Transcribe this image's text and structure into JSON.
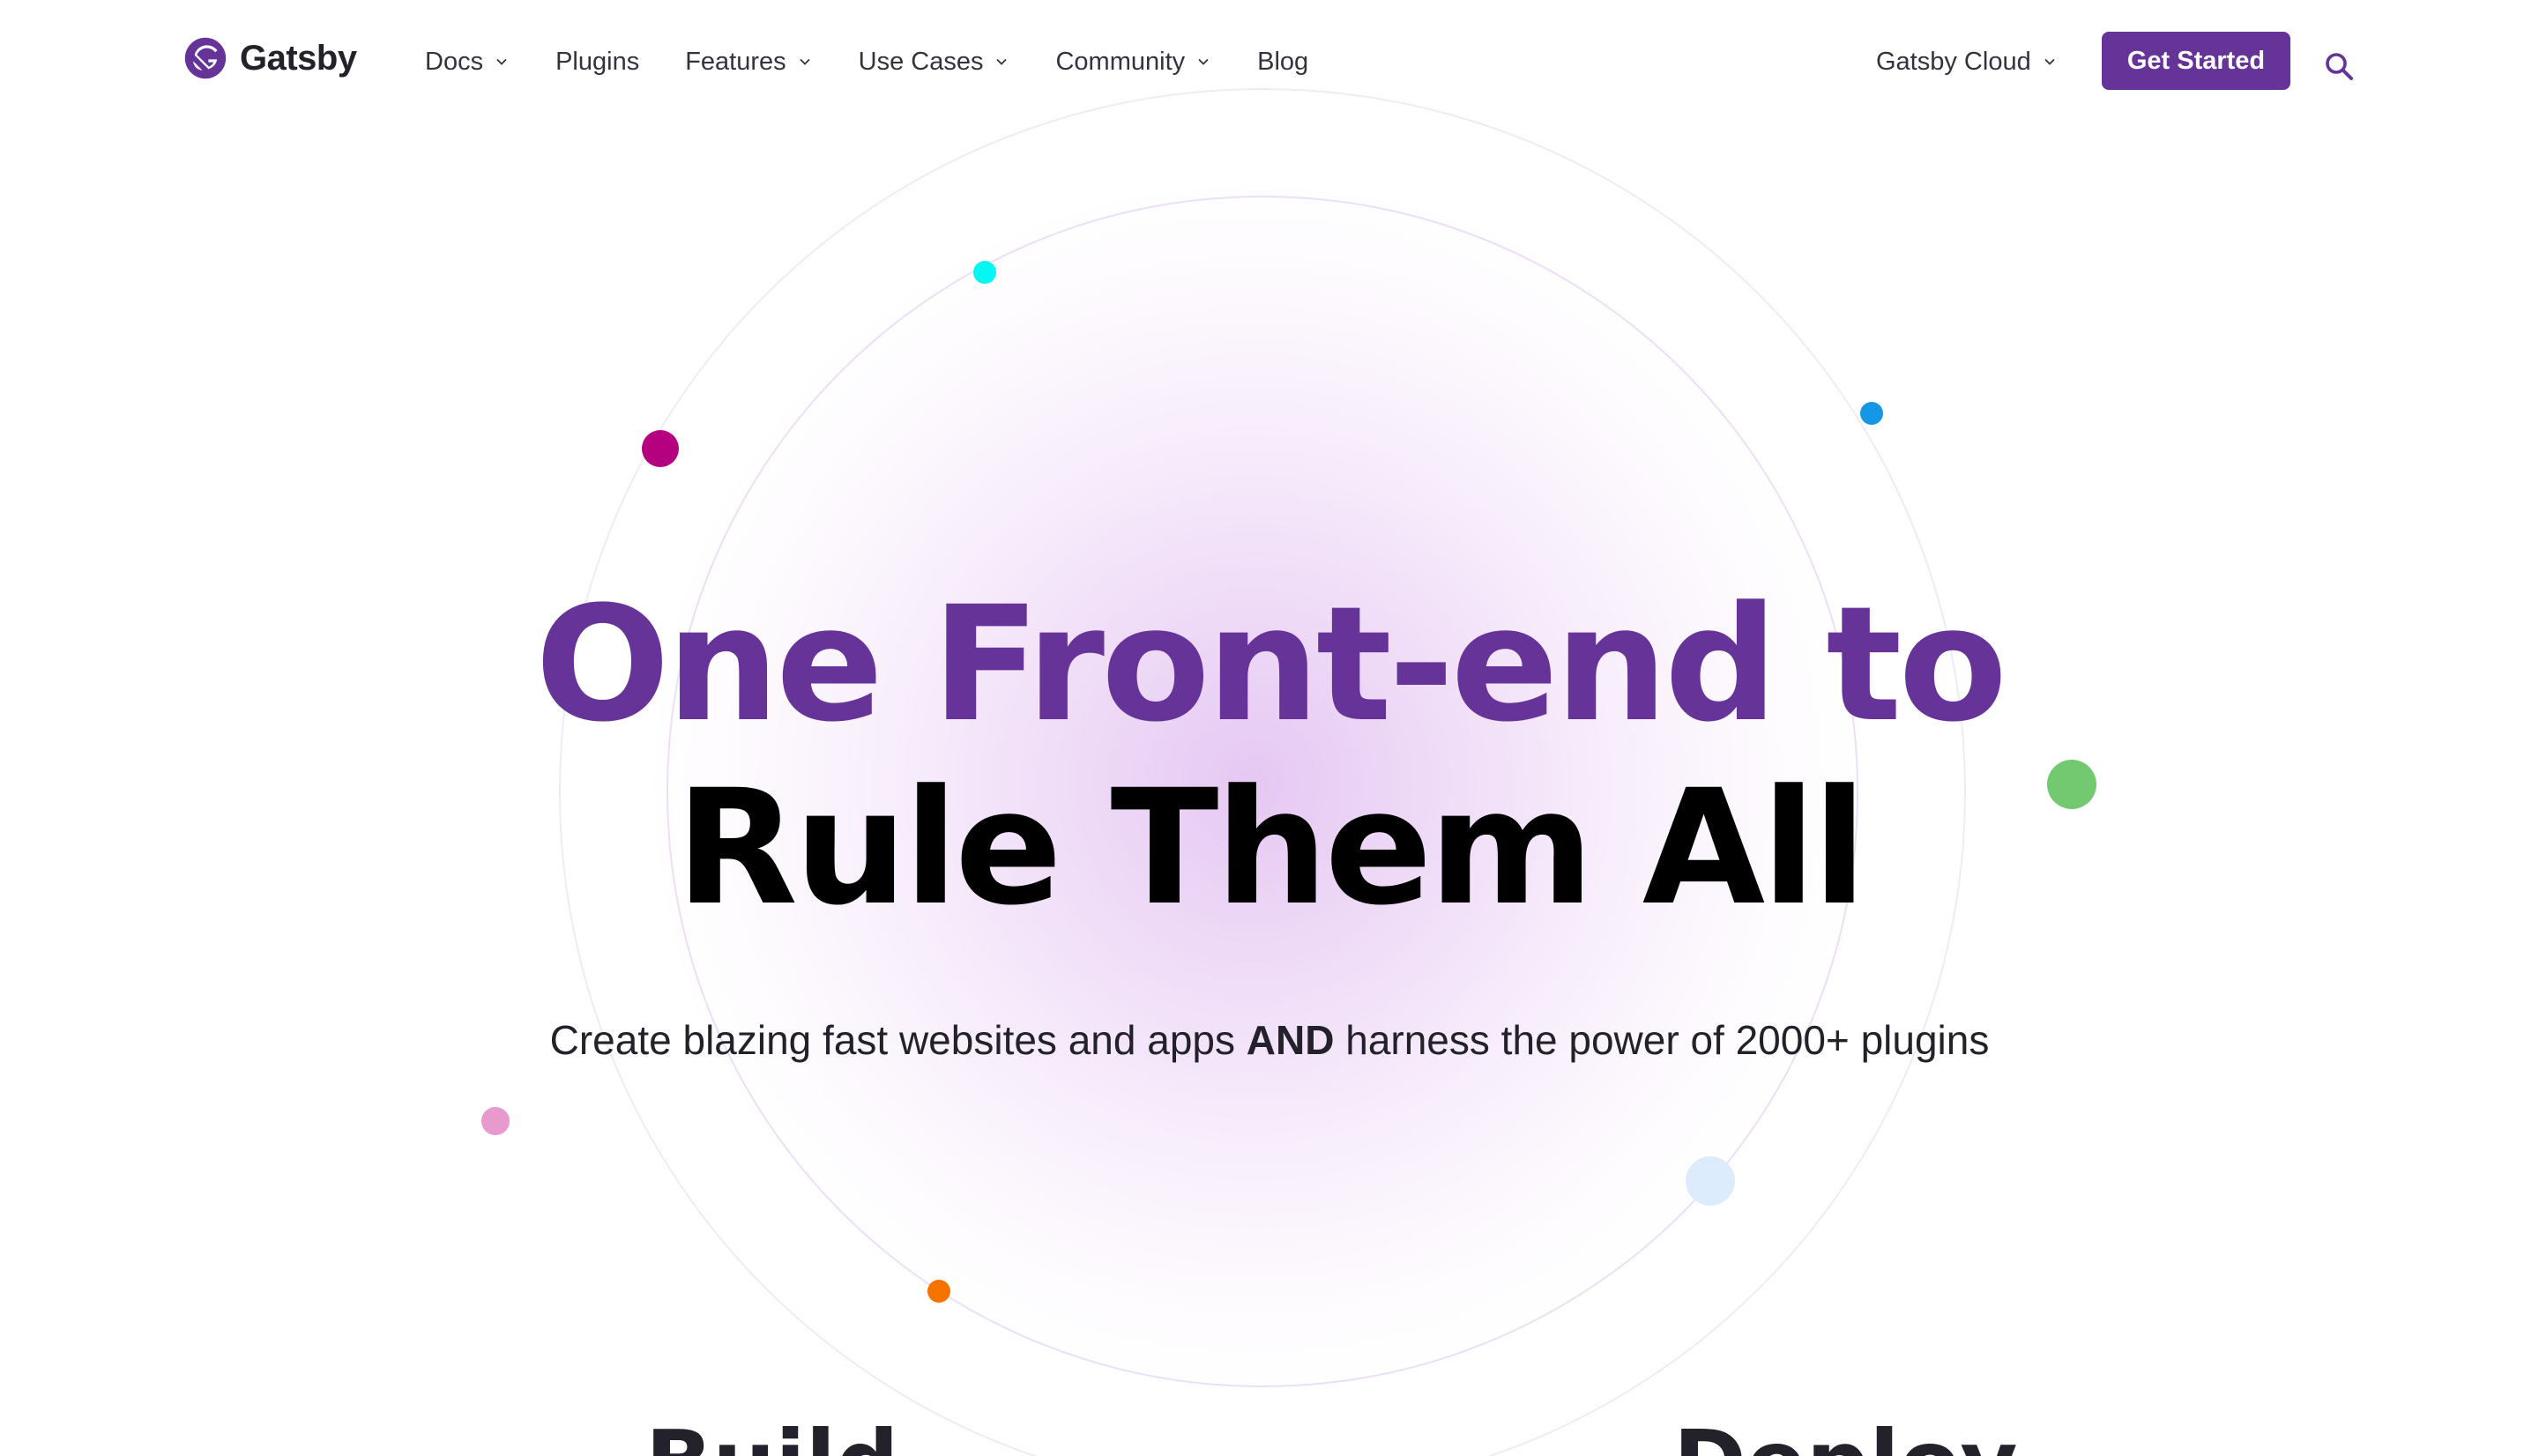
{
  "header": {
    "brand": "Gatsby",
    "nav": [
      {
        "label": "Docs",
        "dropdown": true
      },
      {
        "label": "Plugins",
        "dropdown": false
      },
      {
        "label": "Features",
        "dropdown": true
      },
      {
        "label": "Use Cases",
        "dropdown": true
      },
      {
        "label": "Community",
        "dropdown": true
      },
      {
        "label": "Blog",
        "dropdown": false
      }
    ],
    "cloud_menu": "Gatsby Cloud",
    "cta_label": "Get Started",
    "icons": {
      "logo": "gatsby-logo-icon",
      "search": "search-icon",
      "dropdown": "chevron-down-icon"
    }
  },
  "hero": {
    "headline_line1": "One Front-end to",
    "headline_line2": "Rule Them All",
    "subtitle_before": "Create blazing fast websites and apps ",
    "subtitle_bold": "AND",
    "subtitle_after": " harness the power of 2000+ plugins"
  },
  "sections": {
    "build": "Build",
    "deploy": "Deploy"
  },
  "colors": {
    "brand_purple": "#663399",
    "dots": [
      "#05f7f4",
      "#b5007f",
      "#1597e5",
      "#73c96f",
      "#e899ce",
      "#e8f3ff",
      "#f67300"
    ]
  }
}
